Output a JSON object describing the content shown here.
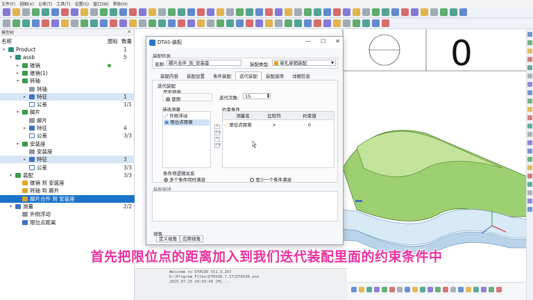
{
  "menu": [
    "文件(F)",
    "视图(V)",
    "公差(T)",
    "工具(T)",
    "设置(S)",
    "窗口(W)",
    "帮助(H)"
  ],
  "tree_panel": {
    "title": "模型树",
    "close": "✕",
    "header": {
      "name": "名称",
      "icon": "图标",
      "count": "数量"
    },
    "rows": [
      {
        "label": "Product",
        "count": "1"
      },
      {
        "label": "assb",
        "count": "5"
      },
      {
        "label": "锥销",
        "count": ""
      },
      {
        "label": "锥销(1)",
        "count": ""
      },
      {
        "label": "转轴",
        "count": ""
      },
      {
        "label": "转轴",
        "count": ""
      },
      {
        "label": "特征",
        "count": "1"
      },
      {
        "label": "公差",
        "count": "1/1"
      },
      {
        "label": "脚片",
        "count": ""
      },
      {
        "label": "脚片",
        "count": ""
      },
      {
        "label": "特征",
        "count": "4"
      },
      {
        "label": "公差",
        "count": "3/3"
      },
      {
        "label": "安装座",
        "count": ""
      },
      {
        "label": "安装座",
        "count": ""
      },
      {
        "label": "特征",
        "count": "3"
      },
      {
        "label": "公差",
        "count": "3/3"
      },
      {
        "label": "装配",
        "count": "3/3"
      },
      {
        "label": "锥销 到 安装座",
        "count": ""
      },
      {
        "label": "转轴 到 脚片",
        "count": ""
      },
      {
        "label": "脚片合件 到 安装座",
        "count": ""
      },
      {
        "label": "测量",
        "count": "2/2"
      },
      {
        "label": "外侧浮动",
        "count": ""
      },
      {
        "label": "限位点距离",
        "count": ""
      }
    ]
  },
  "viewport": {
    "big_number": "0"
  },
  "dialog": {
    "title": "DTAS-装配",
    "controls": {
      "minimize": "—",
      "maximize": "☐",
      "close": "✕"
    },
    "assembly_info": {
      "group_label": "装配信息",
      "name_label": "名称:",
      "name_value": "脚片合件_到_安装座",
      "type_label": "装配类型:",
      "type_value": "单孔单销装配"
    },
    "tabs": [
      "装配内容",
      "装配设置",
      "条件装配",
      "迭代装配",
      "装配选项",
      "详细信息"
    ],
    "active_tab": "迭代装配",
    "iter_group": "迭代装配",
    "enable_group": "是否使用",
    "enable_label": "使用",
    "iter_count_label": "迭代次数:",
    "iter_count_value": "15",
    "candidate_label": "待选测量",
    "candidates": [
      "外侧浮动",
      "限位点距离"
    ],
    "constraint_label": "约束条件",
    "table_headers": [
      "测量名",
      "比较符",
      "约束值"
    ],
    "table_rows": [
      {
        "name": "限位点距离",
        "op": ">",
        "value": "0"
      }
    ],
    "move_buttons": [
      ">",
      ">>",
      "<",
      "<<"
    ],
    "logic_group": "条件项逻辑关系",
    "logic_opt1": "多个条件同时满足",
    "logic_opt2": "至少一个条件满足",
    "desc_label": "装配描述",
    "view_group": "视角",
    "view_btn1": "定义视角",
    "view_btn2": "应用视角"
  },
  "console": {
    "lines": [
      "Welcome  to  DTAS3D  V11.3.267",
      "D:\\Program  Files\\DTAS3D-7.17\\DTAS3D.exe",
      "2025.07.25  20:03:49  [M]..."
    ]
  },
  "subtitle": "首先把限位点的距离加入到我们迭代装配里面的约束条件中",
  "colors": {
    "accent": "#1a73c7",
    "subtitle": "#e8319e",
    "model_green": "#9dd070"
  }
}
